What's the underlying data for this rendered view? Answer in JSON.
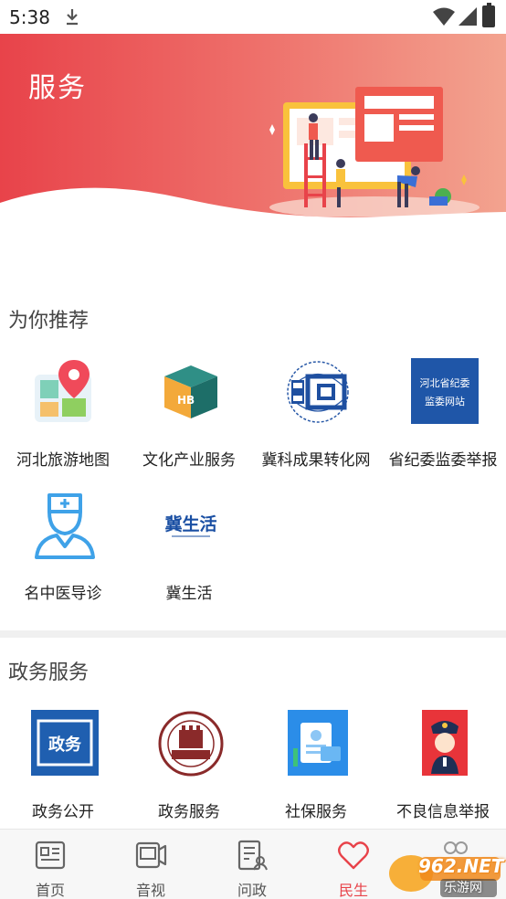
{
  "status_bar": {
    "time": "5:38"
  },
  "banner": {
    "title": "服务"
  },
  "recommend": {
    "title": "为你推荐",
    "items": [
      {
        "label": "河北旅游地图",
        "icon": "map-pin-icon"
      },
      {
        "label": "文化产业服务",
        "icon": "cube-icon"
      },
      {
        "label": "冀科成果转化网",
        "icon": "globe-logo-icon"
      },
      {
        "label": "省纪委监委举报",
        "icon": "discipline-site-icon",
        "icon_text_1": "河北省纪委",
        "icon_text_2": "监委网站"
      },
      {
        "label": "名中医导诊",
        "icon": "doctor-icon"
      },
      {
        "label": "冀生活",
        "icon": "ji-life-logo-icon",
        "icon_text": "冀生活"
      }
    ]
  },
  "gov": {
    "title": "政务服务",
    "items": [
      {
        "label": "政务公开",
        "icon": "gov-open-icon",
        "icon_text": "政务"
      },
      {
        "label": "政务服务",
        "icon": "great-wall-seal-icon"
      },
      {
        "label": "社保服务",
        "icon": "social-security-icon"
      },
      {
        "label": "不良信息举报",
        "icon": "police-report-icon"
      }
    ]
  },
  "bottom_nav": {
    "items": [
      {
        "label": "首页",
        "icon": "news-icon",
        "active": false
      },
      {
        "label": "音视",
        "icon": "video-icon",
        "active": false
      },
      {
        "label": "问政",
        "icon": "question-icon",
        "active": false
      },
      {
        "label": "民生",
        "icon": "heart-icon",
        "active": true
      },
      {
        "label": "",
        "icon": "profile-icon",
        "active": false
      }
    ]
  },
  "watermark": {
    "brand": "962.NET",
    "sub": "乐游网"
  },
  "colors": {
    "accent": "#e8434a",
    "banner_end": "#f3a38f"
  }
}
